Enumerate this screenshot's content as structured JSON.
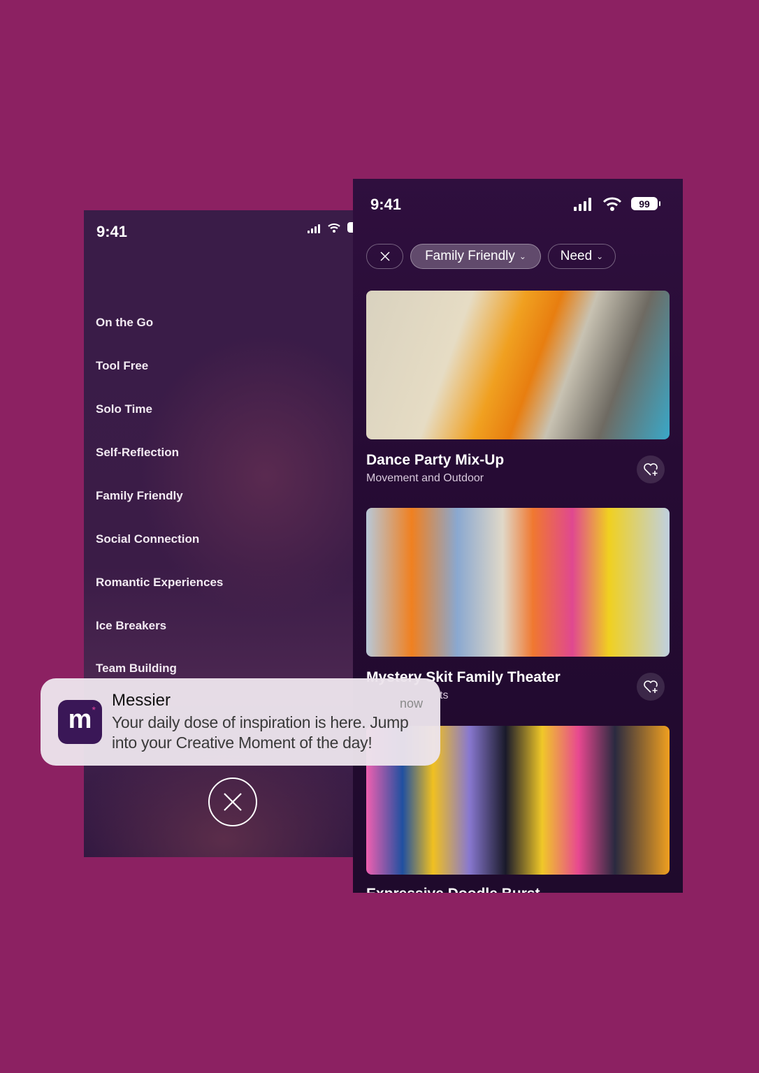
{
  "colors": {
    "background": "#8c2162",
    "panel": "#260b34",
    "notification": "#ece4ec",
    "app_icon": "#3a1757"
  },
  "left_screen": {
    "status": {
      "time": "9:41",
      "icons": [
        "signal-icon",
        "wifi-icon",
        "battery-icon"
      ]
    },
    "menu_items": [
      "On the Go",
      "Tool Free",
      "Solo Time",
      "Self-Reflection",
      "Family Friendly",
      "Social Connection",
      "Romantic Experiences",
      "Ice Breakers",
      "Team Building"
    ],
    "close_icon": "close-icon"
  },
  "right_screen": {
    "status": {
      "time": "9:41",
      "battery": "99"
    },
    "filters": {
      "clear_icon": "close-icon",
      "chips": [
        {
          "label": "Family Friendly",
          "active": true
        },
        {
          "label": "Need",
          "active": false
        }
      ]
    },
    "cards": [
      {
        "title": "Dance Party Mix-Up",
        "subtitle": "Movement and Outdoor",
        "favorite_icon": "heart-plus-icon"
      },
      {
        "title": "Mystery Skit Family Theater",
        "subtitle": "ts",
        "favorite_icon": "heart-plus-icon"
      },
      {
        "title": "Expressive Doodle Burst"
      }
    ]
  },
  "notification": {
    "app_name": "Messier",
    "time": "now",
    "body": "Your daily dose of inspiration is here. Jump into your Creative Moment of the day!",
    "icon_letter": "m"
  }
}
